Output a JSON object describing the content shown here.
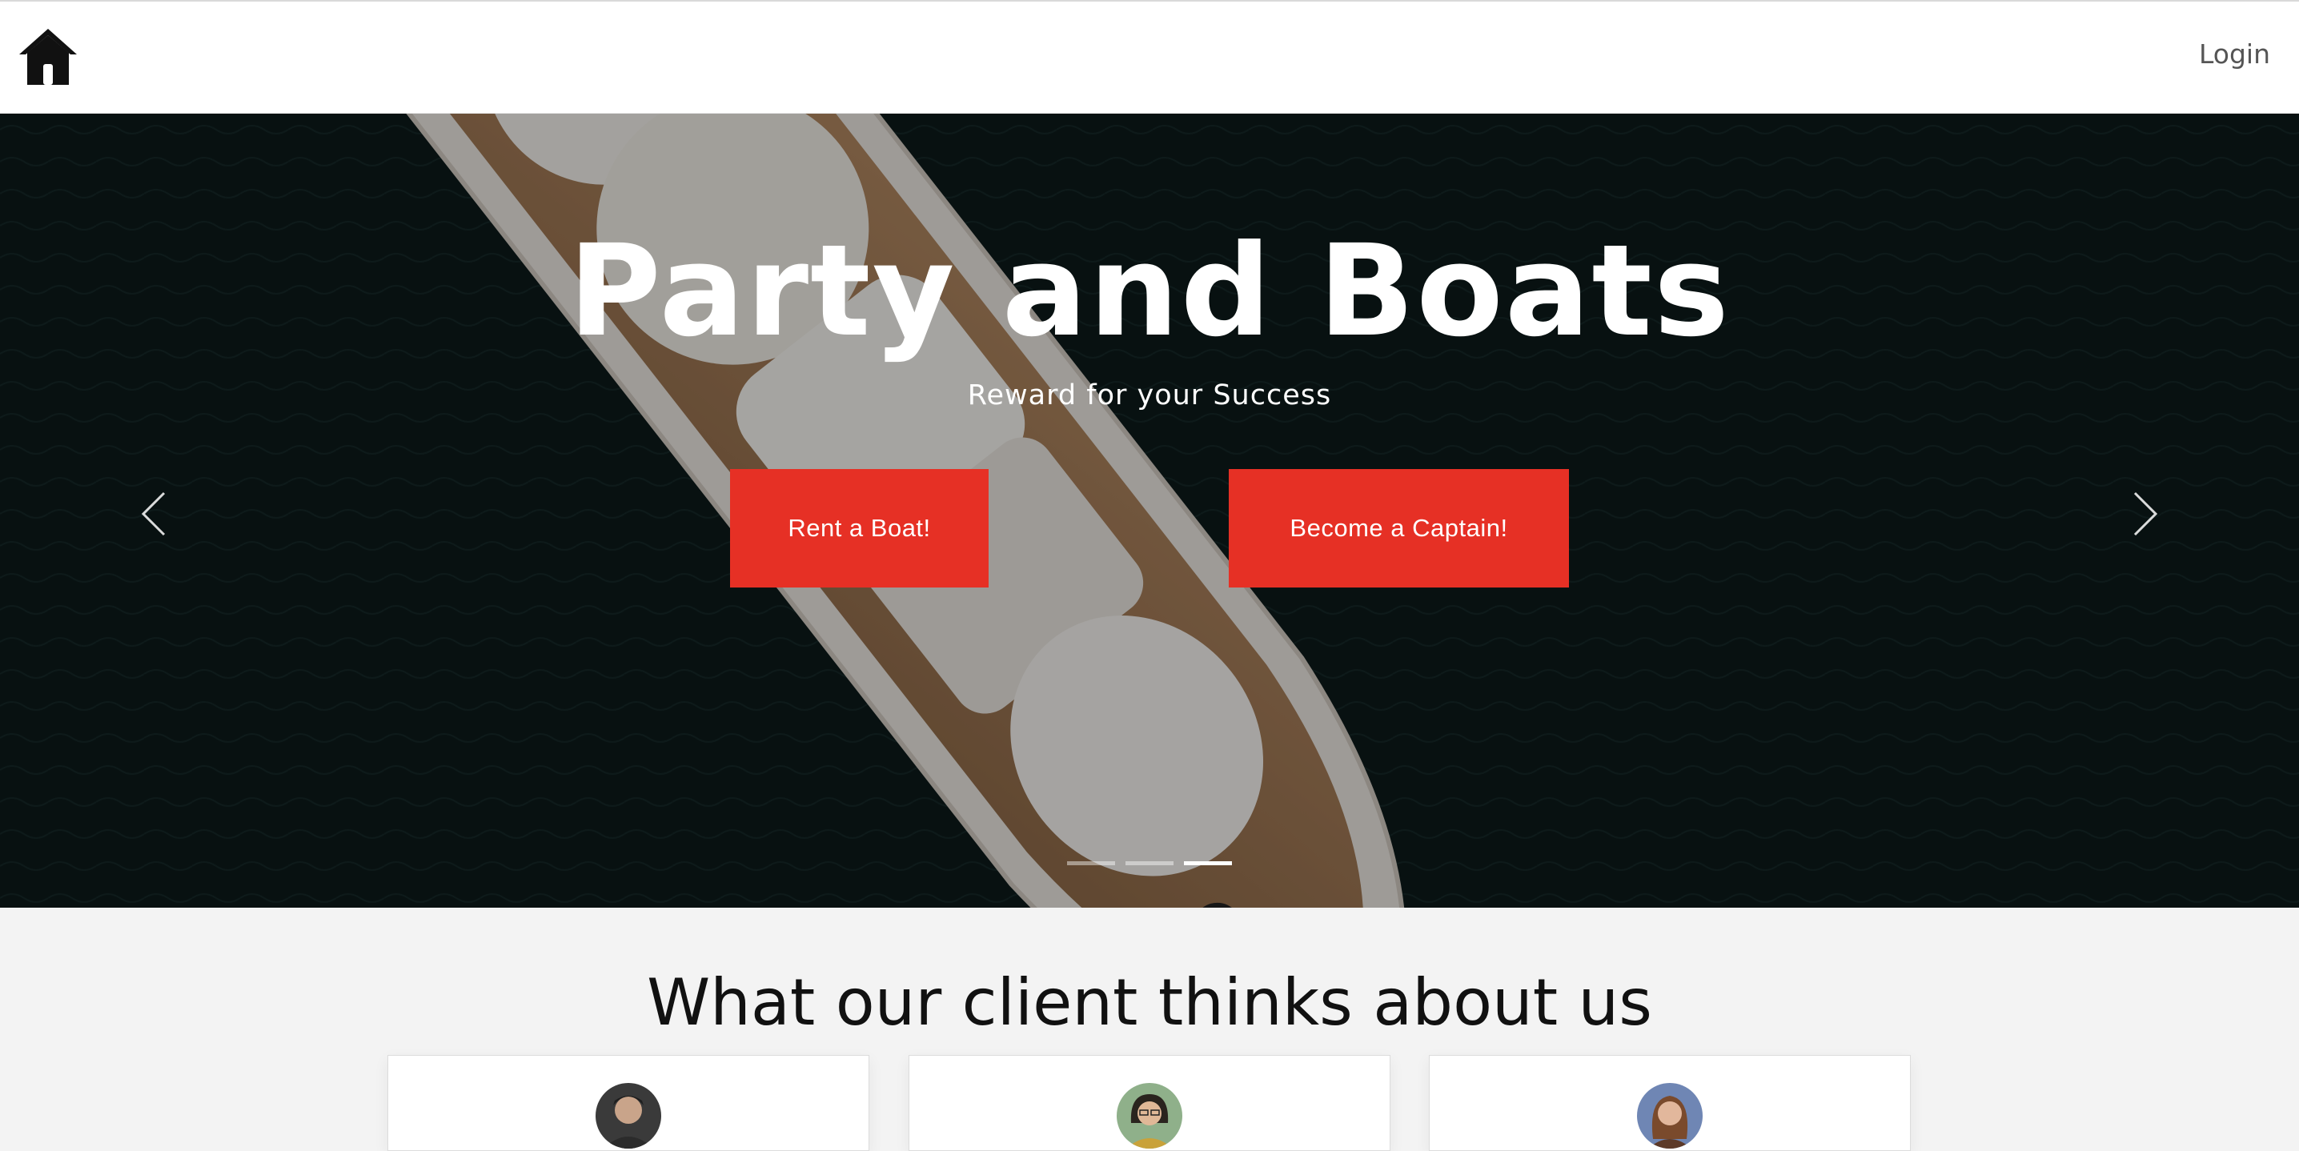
{
  "nav": {
    "home_icon": "home-icon",
    "login_label": "Login"
  },
  "hero": {
    "title": "Party and Boats",
    "subtitle": "Reward for your Success",
    "rent_button": "Rent a Boat!",
    "captain_button": "Become a Captain!",
    "prev_icon": "chevron-left-icon",
    "next_icon": "chevron-right-icon",
    "slides_count": 3,
    "active_slide": 3
  },
  "testimonials": {
    "title": "What our client thinks about us",
    "cards": [
      {
        "avatar": "avatar-man"
      },
      {
        "avatar": "avatar-woman-glasses"
      },
      {
        "avatar": "avatar-woman"
      }
    ]
  },
  "colors": {
    "accent": "#e63025",
    "text_dark": "#111111",
    "hero_bg": "#0d1c1c"
  }
}
